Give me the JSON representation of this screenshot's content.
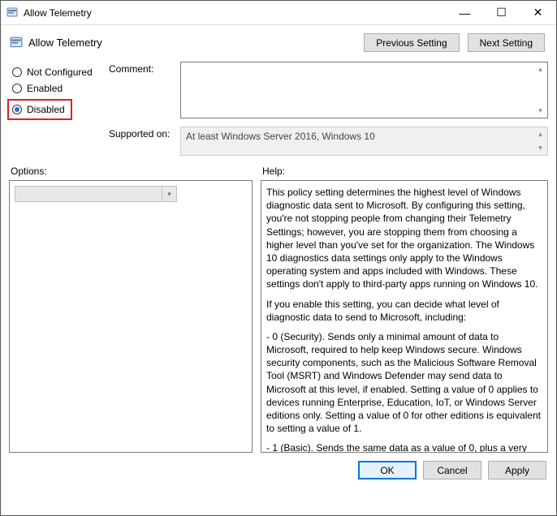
{
  "window": {
    "title": "Allow Telemetry"
  },
  "header": {
    "page_title": "Allow Telemetry",
    "prev_btn": "Previous Setting",
    "next_btn": "Next Setting"
  },
  "radios": {
    "not_configured": "Not Configured",
    "enabled": "Enabled",
    "disabled": "Disabled",
    "selected": "disabled"
  },
  "fields": {
    "comment_label": "Comment:",
    "comment_value": "",
    "supported_label": "Supported on:",
    "supported_value": "At least Windows Server 2016, Windows 10"
  },
  "sections": {
    "options_label": "Options:",
    "help_label": "Help:"
  },
  "help": {
    "p1": "This policy setting determines the highest level of Windows diagnostic data sent to Microsoft. By configuring this setting, you're not stopping people from changing their Telemetry Settings; however, you are stopping them from choosing a higher level than you've set for the organization. The Windows 10 diagnostics data settings only apply to the Windows operating system and apps included with Windows. These settings don't apply to third-party apps running on Windows 10.",
    "p2": "If you enable this setting, you can decide what level of diagnostic data to send to Microsoft, including:",
    "p3": "  - 0 (Security). Sends only a minimal amount of data to Microsoft, required to help keep Windows secure. Windows security components, such as the Malicious Software Removal Tool (MSRT) and Windows Defender may send data to Microsoft at this level, if enabled. Setting a value of 0 applies to devices running Enterprise, Education, IoT, or Windows Server editions only. Setting a value of 0 for other editions is equivalent to setting a value of 1.",
    "p4": "  - 1 (Basic). Sends the same data as a value of 0, plus a very"
  },
  "footer": {
    "ok": "OK",
    "cancel": "Cancel",
    "apply": "Apply"
  }
}
